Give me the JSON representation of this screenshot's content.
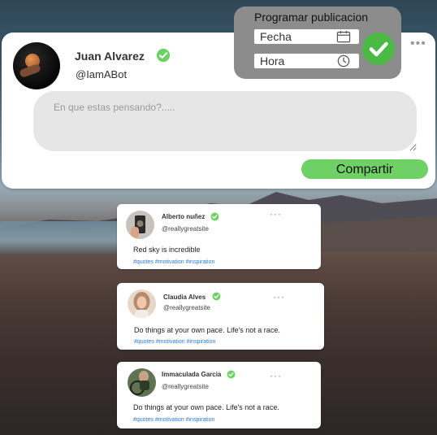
{
  "compose": {
    "user_name": "Juan Alvarez",
    "user_handle": "@IamABot",
    "placeholder": "En que estas pensando?.....",
    "share_label": "Compartir",
    "more_label": "•••"
  },
  "schedule": {
    "title": "Programar publicacion",
    "date_label": "Fecha",
    "time_label": "Hora"
  },
  "colors": {
    "accent_green": "#6fd066",
    "verify_green": "#4cb944",
    "hashtag_blue": "#2a7bd0",
    "panel_gray": "#8c8c8c"
  },
  "posts": [
    {
      "author": "Alberto nuñez",
      "handle": "@reallygreatsite",
      "text": "Red sky is incredible",
      "hashtags": "#quotes #motivation #inspiration",
      "more": "···"
    },
    {
      "author": "Claudia Alves",
      "handle": "@reallygreatsite",
      "text": "Do things at your own pace.  Life's not a race.",
      "hashtags": "#quotes #motivation #inspiration",
      "more": "···"
    },
    {
      "author": "Immaculada Garcia",
      "handle": "@reallygreatsite",
      "text": "Do things at your own pace.  Life's not a race.",
      "hashtags": "#quotes #motivation #inspiration",
      "more": "···"
    }
  ]
}
